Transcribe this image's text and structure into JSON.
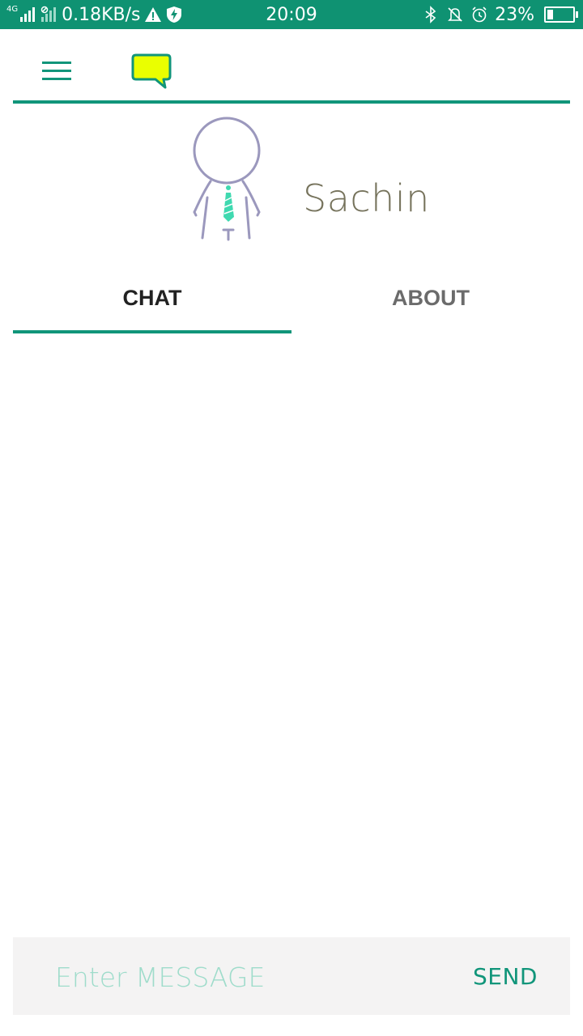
{
  "status_bar": {
    "network_type": "4G",
    "speed": "0.18KB/s",
    "time": "20:09",
    "battery": "23%",
    "battery_level": 0.23,
    "icons": [
      "signal-icon",
      "no-sim-signal-icon",
      "warning-icon",
      "shield-bolt-icon",
      "bluetooth-icon",
      "notifications-off-icon",
      "alarm-icon",
      "battery-icon"
    ]
  },
  "app_bar": {
    "icons": [
      "menu-icon",
      "chat-bubble-logo-icon"
    ]
  },
  "profile": {
    "name": "Sachin",
    "avatar_icon": "avatar-person-icon"
  },
  "tabs": [
    {
      "label": "CHAT",
      "active": true
    },
    {
      "label": "ABOUT",
      "active": false
    }
  ],
  "composer": {
    "placeholder": "Enter MESSAGE",
    "value": "",
    "send_label": "SEND"
  },
  "colors": {
    "accent": "#11957a",
    "status_bar": "#0f9272",
    "logo_fill": "#eaff00",
    "name_text": "#76735c",
    "placeholder_text": "#9fdccb",
    "composer_bg": "#f4f3f3"
  }
}
